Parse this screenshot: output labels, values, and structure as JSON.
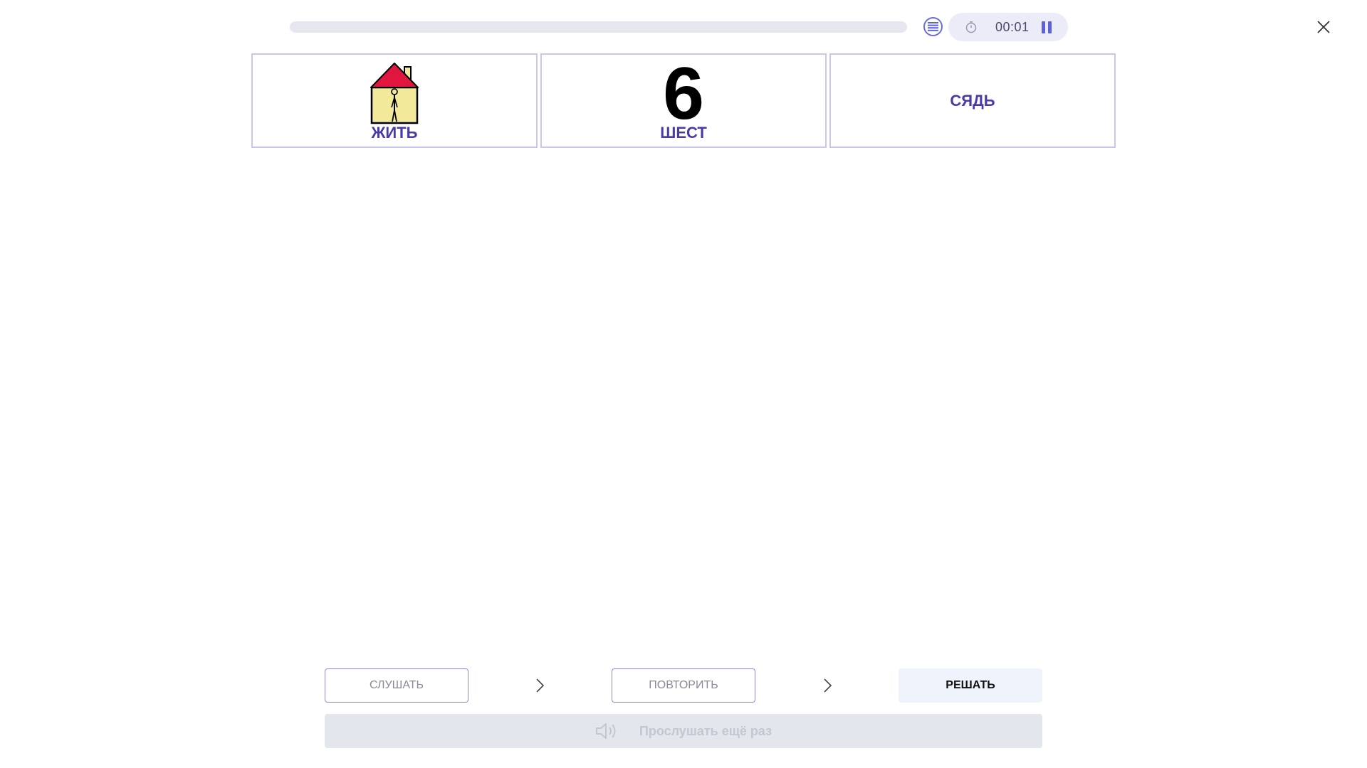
{
  "header": {
    "progress_fraction": 0.0,
    "timer": "00:01",
    "icons": {
      "list": "list-icon",
      "timer": "stopwatch-icon",
      "pause": "pause-icon",
      "close": "close-icon"
    }
  },
  "cards": [
    {
      "label": "ЖИТЬ",
      "picture": "house-with-person-icon"
    },
    {
      "label": "ШЕСТ",
      "number": "6"
    },
    {
      "label": "СЯДЬ"
    }
  ],
  "steps": {
    "listen": "СЛУШАТЬ",
    "repeat": "ПОВТОРИТЬ",
    "solve": "РЕШАТЬ"
  },
  "replay": {
    "label": "Прослушать ещё раз",
    "icon": "speaker-icon"
  },
  "colors": {
    "accent": "#4a3aa8",
    "progress": "#5b4fd8",
    "card_border": "#c9c7ec"
  }
}
